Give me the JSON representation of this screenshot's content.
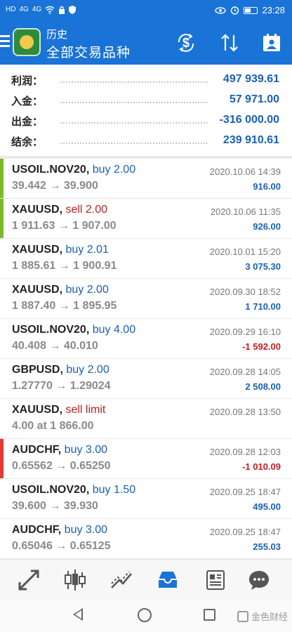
{
  "status_bar": {
    "left_icons": [
      "HD",
      "4G",
      "4G"
    ],
    "time": "23:28"
  },
  "app_bar": {
    "subtitle": "历史",
    "title": "全部交易品种"
  },
  "summary": [
    {
      "label": "利润：",
      "value": "497 939.61"
    },
    {
      "label": "入金：",
      "value": "57 971.00"
    },
    {
      "label": "出金：",
      "value": "-316 000.00"
    },
    {
      "label": "结余：",
      "value": "239 910.61"
    }
  ],
  "colors": {
    "header": "#1a73d6",
    "value_blue": "#1a5fb4",
    "buy_blue": "#1a5fb4",
    "sell_red": "#b22222",
    "loss_red": "#c21d1d",
    "marker_green": "#7cbb28",
    "marker_red": "#e53935"
  },
  "trades": [
    {
      "symbol": "USOIL.NOV20",
      "side": "buy 2.00",
      "side_type": "buy",
      "prices": "39.442 → 39.900",
      "time": "2020.10.06 14:39",
      "profit": "916.00",
      "profit_type": "gain",
      "marker": "green"
    },
    {
      "symbol": "XAUUSD",
      "side": "sell 2.00",
      "side_type": "sell",
      "prices": "1 911.63 → 1 907.00",
      "time": "2020.10.06 11:35",
      "profit": "926.00",
      "profit_type": "gain",
      "marker": "green"
    },
    {
      "symbol": "XAUUSD",
      "side": "buy 2.01",
      "side_type": "buy",
      "prices": "1 885.61 → 1 900.91",
      "time": "2020.10.01 15:20",
      "profit": "3 075.30",
      "profit_type": "gain",
      "marker": ""
    },
    {
      "symbol": "XAUUSD",
      "side": "buy 2.00",
      "side_type": "buy",
      "prices": "1 887.40 → 1 895.95",
      "time": "2020.09.30 18:52",
      "profit": "1 710.00",
      "profit_type": "gain",
      "marker": ""
    },
    {
      "symbol": "USOIL.NOV20",
      "side": "buy 4.00",
      "side_type": "buy",
      "prices": "40.408 → 40.010",
      "time": "2020.09.29 16:10",
      "profit": "-1 592.00",
      "profit_type": "loss",
      "marker": ""
    },
    {
      "symbol": "GBPUSD",
      "side": "buy 2.00",
      "side_type": "buy",
      "prices": "1.27770 → 1.29024",
      "time": "2020.09.28 14:05",
      "profit": "2 508.00",
      "profit_type": "gain",
      "marker": ""
    },
    {
      "symbol": "XAUUSD",
      "side": "sell limit",
      "side_type": "sell",
      "prices": "4.00 at 1 866.00",
      "time": "2020.09.28 13:50",
      "profit": "",
      "profit_type": "none",
      "marker": ""
    },
    {
      "symbol": "AUDCHF",
      "side": "buy 3.00",
      "side_type": "buy",
      "prices": "0.65562 → 0.65250",
      "time": "2020.09.28 12:03",
      "profit": "-1 010.09",
      "profit_type": "loss",
      "marker": "red"
    },
    {
      "symbol": "USOIL.NOV20",
      "side": "buy 1.50",
      "side_type": "buy",
      "prices": "39.600 → 39.930",
      "time": "2020.09.25 18:47",
      "profit": "495.00",
      "profit_type": "gain",
      "marker": ""
    },
    {
      "symbol": "AUDCHF",
      "side": "buy 3.00",
      "side_type": "buy",
      "prices": "0.65046 → 0.65125",
      "time": "2020.09.25 18:47",
      "profit": "255.03",
      "profit_type": "gain",
      "marker": ""
    }
  ],
  "bottom_nav": [
    {
      "icon": "quotes-arrows-icon"
    },
    {
      "icon": "candlestick-chart-icon"
    },
    {
      "icon": "trend-chart-icon"
    },
    {
      "icon": "history-inbox-icon",
      "active": true
    },
    {
      "icon": "news-icon"
    },
    {
      "icon": "chat-icon"
    }
  ],
  "watermark": "金色财经"
}
